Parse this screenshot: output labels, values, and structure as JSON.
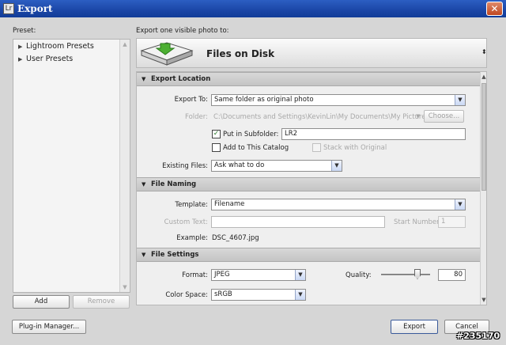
{
  "window": {
    "title": "Export",
    "close_glyph": "✕",
    "icon_glyph": "Lr"
  },
  "presets": {
    "label": "Preset:",
    "items": [
      {
        "label": "Lightroom Presets",
        "icon": "triangle-right-icon"
      },
      {
        "label": "User Presets",
        "icon": "triangle-right-icon"
      }
    ],
    "add_label": "Add",
    "remove_label": "Remove"
  },
  "destination": {
    "label": "Export one visible photo to:",
    "name": "Files on Disk",
    "arrows": "⬍"
  },
  "export_location": {
    "header": "Export Location",
    "export_to_label": "Export To:",
    "export_to_value": "Same folder as original photo",
    "folder_label": "Folder:",
    "folder_value": "C:\\Documents and Settings\\KevinLin\\My Documents\\My Pictures",
    "choose_label": "Choose...",
    "put_in_subfolder_label": "Put in Subfolder:",
    "put_in_subfolder_checked": true,
    "subfolder_value": "LR2",
    "add_to_catalog_label": "Add to This Catalog",
    "add_to_catalog_checked": false,
    "stack_label": "Stack with Original",
    "existing_files_label": "Existing Files:",
    "existing_files_value": "Ask what to do"
  },
  "file_naming": {
    "header": "File Naming",
    "template_label": "Template:",
    "template_value": "Filename",
    "custom_text_label": "Custom Text:",
    "custom_text_value": "",
    "start_number_label": "Start Number:",
    "start_number_value": "1",
    "example_label": "Example:",
    "example_value": "DSC_4607.jpg"
  },
  "file_settings": {
    "header": "File Settings",
    "format_label": "Format:",
    "format_value": "JPEG",
    "quality_label": "Quality:",
    "quality_value": "80",
    "quality_fraction": 0.8,
    "color_space_label": "Color Space:",
    "color_space_value": "sRGB"
  },
  "footer": {
    "plugin_manager_label": "Plug-in Manager...",
    "export_label": "Export",
    "cancel_label": "Cancel"
  },
  "watermark": "#235170",
  "colors": {
    "titlebar": "#1b46a6",
    "dialog": "#d6d6d6",
    "dropdown_arrow": "#c9d8f4"
  }
}
